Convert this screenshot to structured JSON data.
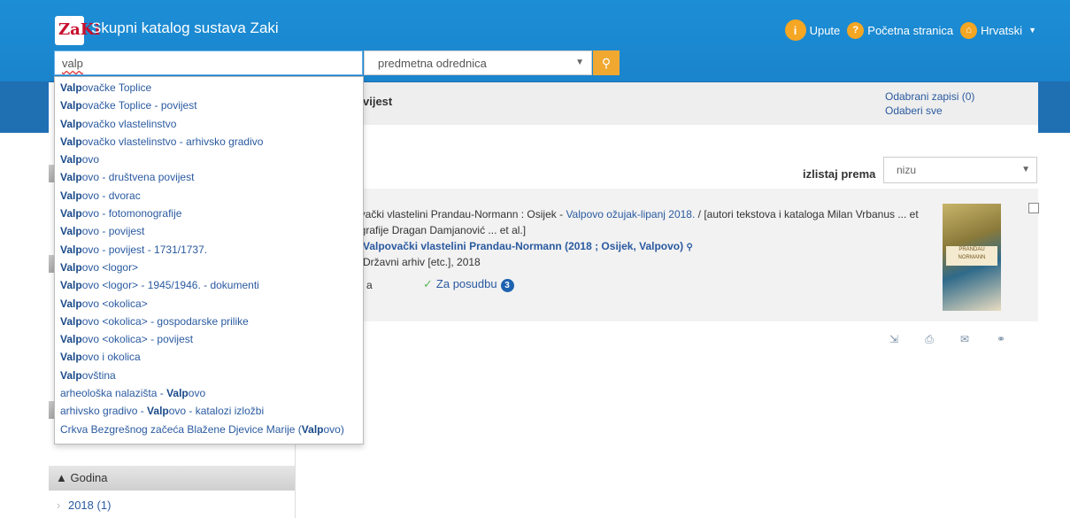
{
  "header": {
    "logo_text": "ZaKi",
    "title": "Skupni katalog sustava Zaki",
    "nav": [
      {
        "label": "Upute",
        "icon": "info-icon"
      },
      {
        "label": "Početna stranica",
        "icon": "help-icon"
      },
      {
        "label": "Hrvatski",
        "icon": "home-icon"
      }
    ]
  },
  "search": {
    "query": "valp",
    "type_selected": "predmetna odrednica",
    "button_icon": "search-icon"
  },
  "suggestions": [
    {
      "pre": "",
      "match": "Valp",
      "post": "ovačke Toplice"
    },
    {
      "pre": "",
      "match": "Valp",
      "post": "ovačke Toplice - povijest"
    },
    {
      "pre": "",
      "match": "Valp",
      "post": "ovačko vlastelinstvo"
    },
    {
      "pre": "",
      "match": "Valp",
      "post": "ovačko vlastelinstvo - arhivsko gradivo"
    },
    {
      "pre": "",
      "match": "Valp",
      "post": "ovo"
    },
    {
      "pre": "",
      "match": "Valp",
      "post": "ovo - društvena povijest"
    },
    {
      "pre": "",
      "match": "Valp",
      "post": "ovo - dvorac"
    },
    {
      "pre": "",
      "match": "Valp",
      "post": "ovo - fotomonografije"
    },
    {
      "pre": "",
      "match": "Valp",
      "post": "ovo - povijest"
    },
    {
      "pre": "",
      "match": "Valp",
      "post": "ovo - povijest - 1731/1737."
    },
    {
      "pre": "",
      "match": "Valp",
      "post": "ovo <logor>"
    },
    {
      "pre": "",
      "match": "Valp",
      "post": "ovo <logor> - 1945/1946. - dokumenti"
    },
    {
      "pre": "",
      "match": "Valp",
      "post": "ovo <okolica>"
    },
    {
      "pre": "",
      "match": "Valp",
      "post": "ovo <okolica> - gospodarske prilike"
    },
    {
      "pre": "",
      "match": "Valp",
      "post": "ovo <okolica> - povijest"
    },
    {
      "pre": "",
      "match": "Valp",
      "post": "ovo i okolica"
    },
    {
      "pre": "",
      "match": "Valp",
      "post": "ovština"
    },
    {
      "pre": "arheološka nalazišta - ",
      "match": "Valp",
      "post": "ovo"
    },
    {
      "pre": "arhivsko gradivo - ",
      "match": "Valp",
      "post": "ovo - katalozi izložbi"
    },
    {
      "pre": "Crkva Bezgrešnog začeća Blažene Djevice Marije (",
      "match": "Valp",
      "post": "ovo)"
    }
  ],
  "results": {
    "breadcrumb": "vijest",
    "selected_records": "Odabrani zapisi (0)",
    "select_all": "Odaberi sve",
    "sort_label": "izlistaj prema",
    "sort_value": "nizu",
    "record": {
      "line1_prefix": "ovački vlastelini Prandau-Normann : Osijek - ",
      "line1_link": "Valpovo ožujak-lipanj 2018.",
      "line1_suffix": " / [autori tekstova i kataloga Milan Vrbanus ... et",
      "line2": "ografije Dragan Damjanović ... et al.]",
      "line3": "Valpovački vlastelini Prandau-Normann (2018 ; Osijek, Valpovo)",
      "line4": "Državni arhiv [etc.], 2018",
      "line5": "a",
      "availability": "Za posudbu",
      "availability_count": "3",
      "cover_text": "PRANDAU NORMANN"
    }
  },
  "facets": {
    "heading": "Godina",
    "items": [
      {
        "label": "2018",
        "count": "(1)"
      }
    ]
  }
}
